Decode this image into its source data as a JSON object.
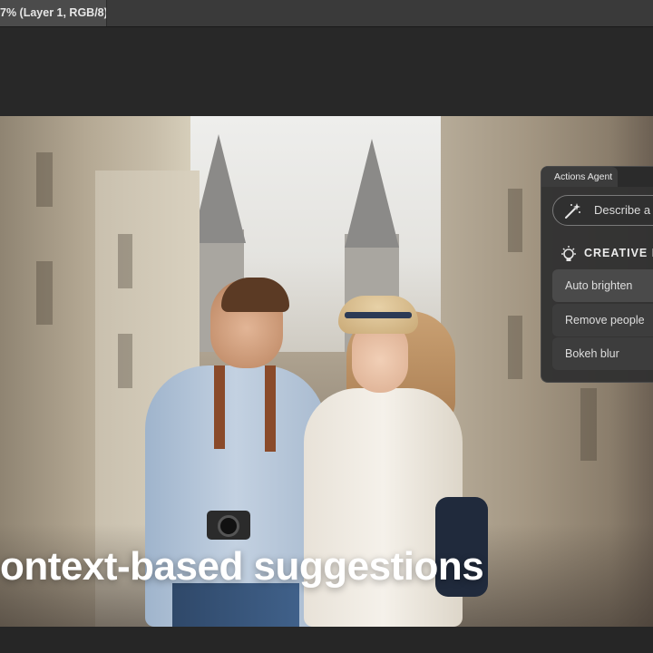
{
  "document_tab": {
    "title": "7% (Layer 1, RGB/8)"
  },
  "caption": {
    "text": "ontext-based suggestions"
  },
  "actions_panel": {
    "tab_label": "Actions Agent",
    "prompt_placeholder": "Describe a c",
    "creative_ideas_label": "CREATIVE ID",
    "suggestions": [
      {
        "label": "Auto brighten"
      },
      {
        "label": "Remove people"
      },
      {
        "label": "Bokeh blur"
      }
    ]
  },
  "icons": {
    "prompt_icon": "magic-wand-icon",
    "ideas_icon": "lightbulb-icon"
  },
  "colors": {
    "app_background": "#262626",
    "panel_background": "#323232",
    "tab_strip": "#3a3a3a"
  }
}
